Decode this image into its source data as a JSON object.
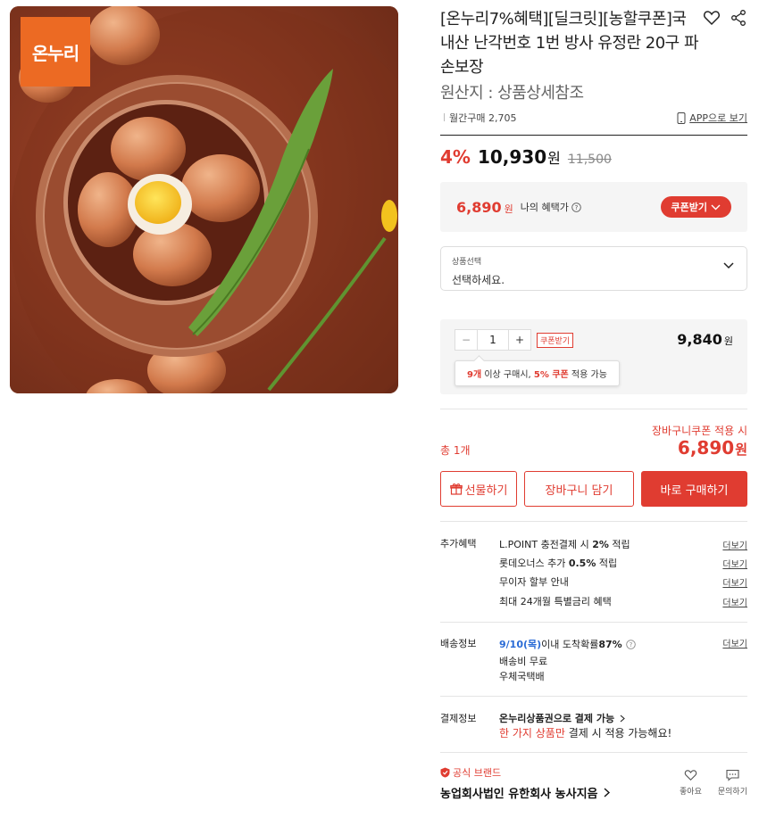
{
  "product": {
    "badge_text": "온누리",
    "title": "[온누리7%혜택][딜크릿][농할쿠폰]국내산 난각번호 1번 방사 유정란 20구 파손보장",
    "origin": "원산지 : 상품상세참조",
    "monthly_sales": "월간구매 2,705",
    "app_link": "APP으로 보기"
  },
  "pricing": {
    "discount": "4%",
    "price": "10,930",
    "price_unit": "원",
    "original": "11,500"
  },
  "benefit": {
    "price": "6,890",
    "unit": "원",
    "label": "나의 혜택가",
    "coupon_button": "쿠폰받기"
  },
  "select": {
    "caption": "상품선택",
    "value": "선택하세요."
  },
  "option": {
    "qty": "1",
    "coupon_tag": "쿠폰받기",
    "price": "9,840",
    "unit": "원",
    "tooltip_count": "9개",
    "tooltip_mid": " 이상 구매시, ",
    "tooltip_coupon": "5% 쿠폰",
    "tooltip_end": " 적용 가능"
  },
  "total": {
    "cart_coupon": "장바구니쿠폰 적용 시",
    "label": "총 1개",
    "price": "6,890",
    "unit": "원"
  },
  "buttons": {
    "gift": "선물하기",
    "cart": "장바구니 담기",
    "buy": "바로 구매하기"
  },
  "extra_benefit": {
    "header": "추가혜택",
    "more": "더보기",
    "items": [
      {
        "pre": "L.POINT 충전결제 시 ",
        "bold": "2%",
        "post": " 적립"
      },
      {
        "pre": "롯데오너스 추가 ",
        "bold": "0.5%",
        "post": " 적립"
      },
      {
        "pre": "무이자 할부 안내",
        "bold": "",
        "post": ""
      },
      {
        "pre": "최대 24개월 특별금리 혜택",
        "bold": "",
        "post": ""
      }
    ]
  },
  "shipping": {
    "header": "배송정보",
    "more": "더보기",
    "date": "9/10(목)",
    "arrival": " 이내 도착확률 ",
    "prob": "87%",
    "fee": "배송비 무료",
    "carrier": "우체국택배"
  },
  "payment": {
    "header": "결제정보",
    "line1": "온누리상품권으로 결제 가능",
    "line2_red": "한 가지 상품만",
    "line2_rest": " 결제 시 적용 가능해요!"
  },
  "brand": {
    "tag": "공식 브랜드",
    "name": "농업회사법인 유한회사 농사지음",
    "like": "좋아요",
    "inquiry": "문의하기"
  },
  "colors": {
    "accent": "#e03c31",
    "badge": "#ec6a23",
    "link_blue": "#2a6bd6"
  }
}
